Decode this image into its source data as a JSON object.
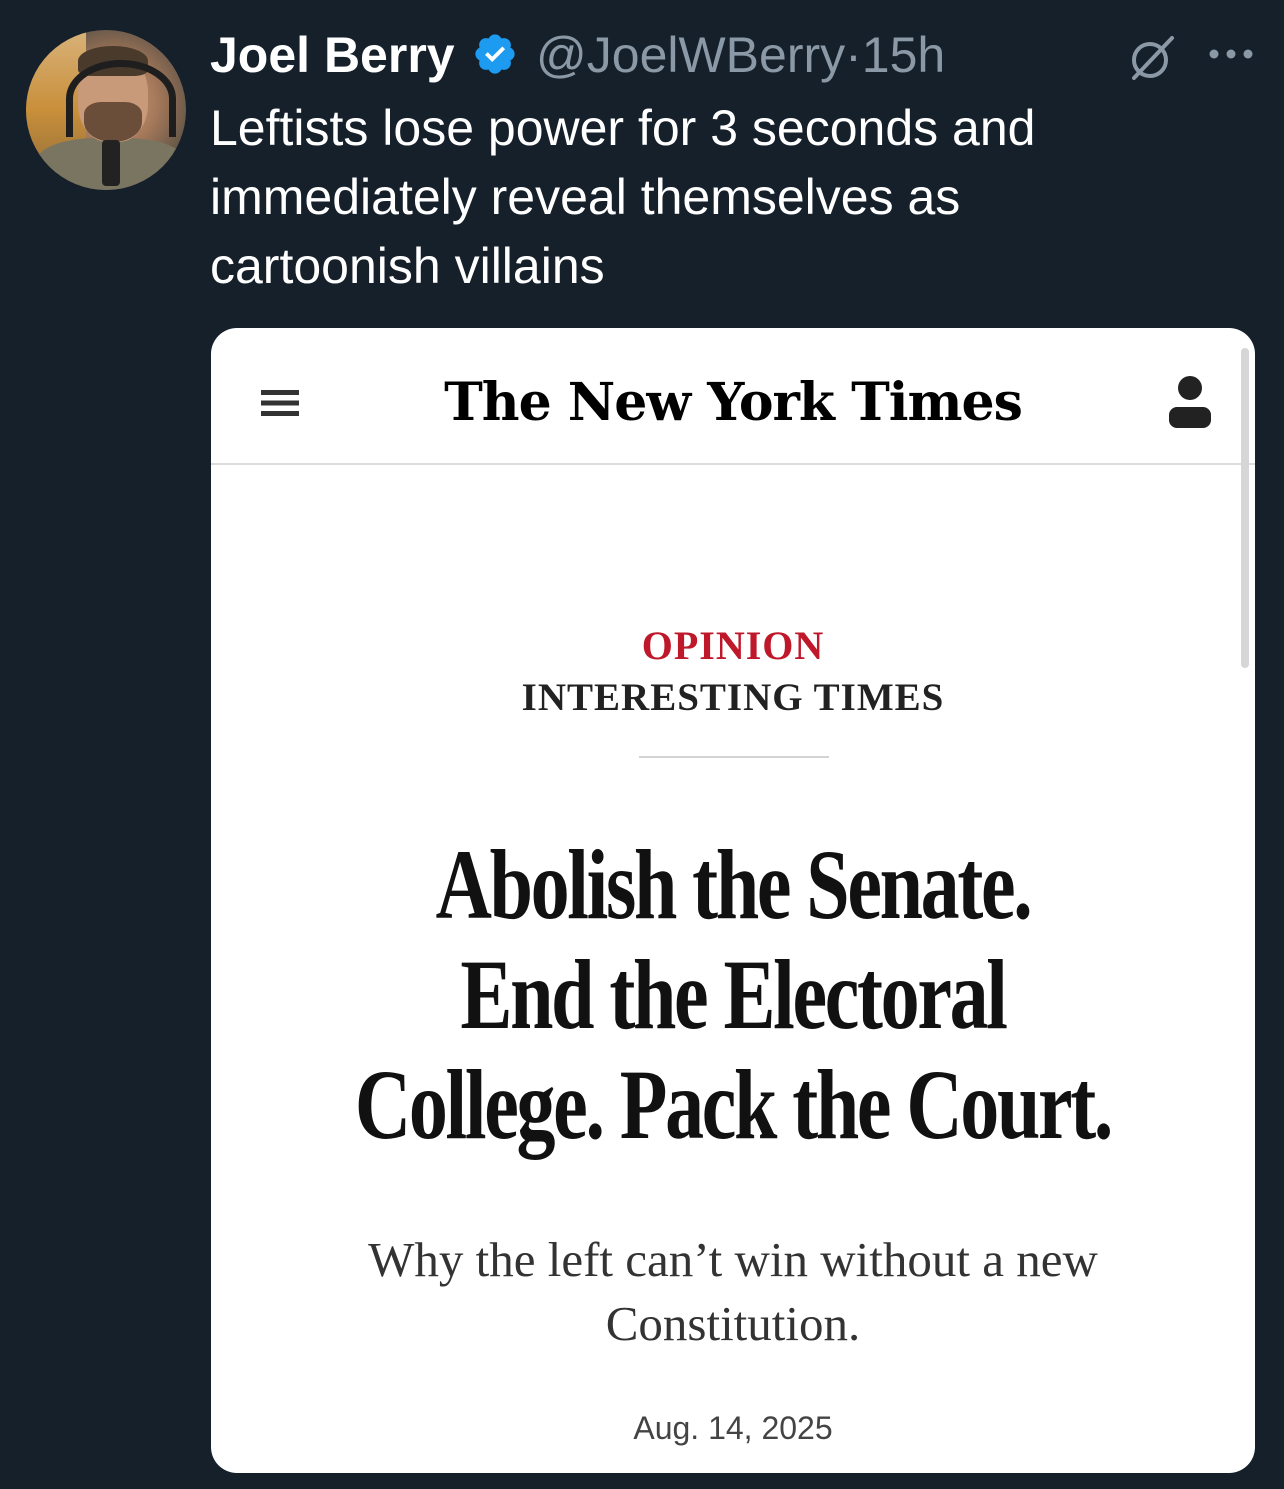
{
  "tweet": {
    "author_name": "Joel Berry",
    "handle": "@JoelWBerry",
    "separator": "·",
    "timestamp": "15h",
    "text_lines": [
      "Leftists lose power for 3 seconds and",
      "immediately reveal themselves as",
      "cartoonish villains"
    ],
    "icons": {
      "avatar": "avatar",
      "verified": "verified-badge-icon",
      "grok": "grok-icon",
      "more": "more-options-icon"
    },
    "colors": {
      "background": "#15202b",
      "verified": "#1d9bf0",
      "handle": "#8b98a5"
    }
  },
  "card": {
    "masthead": "The New York Times",
    "kicker": "OPINION",
    "column": "INTERESTING TIMES",
    "headline_lines": [
      "Abolish the Senate.",
      "End the Electoral",
      "College. Pack the Court."
    ],
    "dek_lines": [
      "Why the left can’t win without a new",
      "Constitution."
    ],
    "date": "Aug. 14, 2025",
    "icons": {
      "menu": "hamburger-menu-icon",
      "account": "account-icon"
    },
    "colors": {
      "kicker": "#c0182b",
      "card_bg": "#ffffff"
    }
  }
}
